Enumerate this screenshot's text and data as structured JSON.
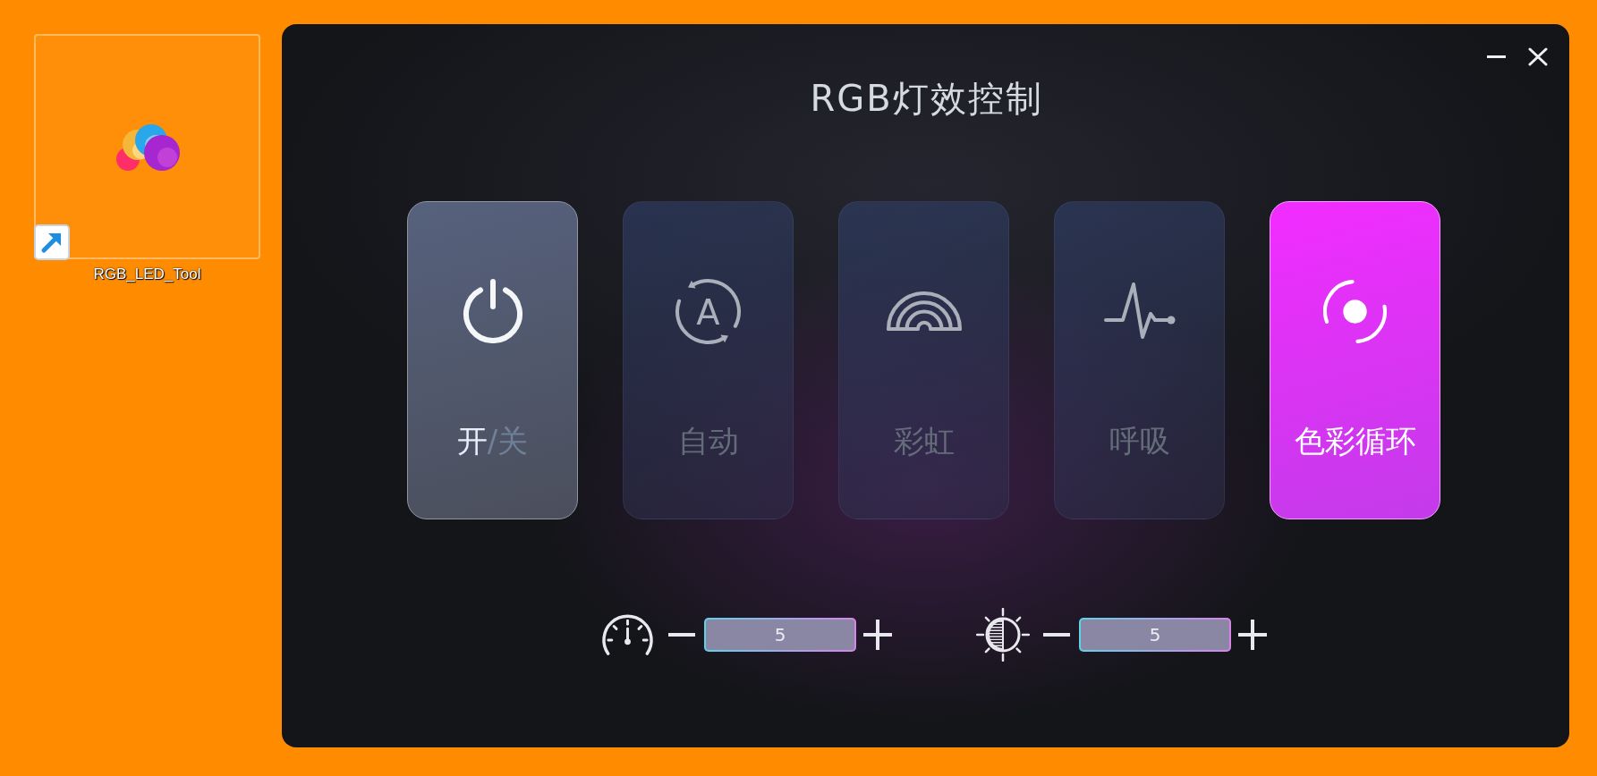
{
  "desktop": {
    "icons": [
      {
        "label": "RGB_LED_Tool",
        "selected": true,
        "shortcut": true
      }
    ]
  },
  "window": {
    "title": "RGB灯效控制"
  },
  "power": {
    "on_text": "开",
    "separator": "/",
    "off_text": "关",
    "on": true
  },
  "modes": [
    {
      "kind": "auto",
      "glyph": "A",
      "label": "自动",
      "selected": false
    },
    {
      "kind": "rainbow",
      "label": "彩虹",
      "selected": false
    },
    {
      "kind": "breathing",
      "label": "呼吸",
      "selected": false
    },
    {
      "kind": "color_cycle",
      "label": "色彩循环",
      "selected": true
    }
  ],
  "adjusters": [
    {
      "kind": "speed",
      "value": "5"
    },
    {
      "kind": "brightness",
      "value": "5"
    }
  ]
}
